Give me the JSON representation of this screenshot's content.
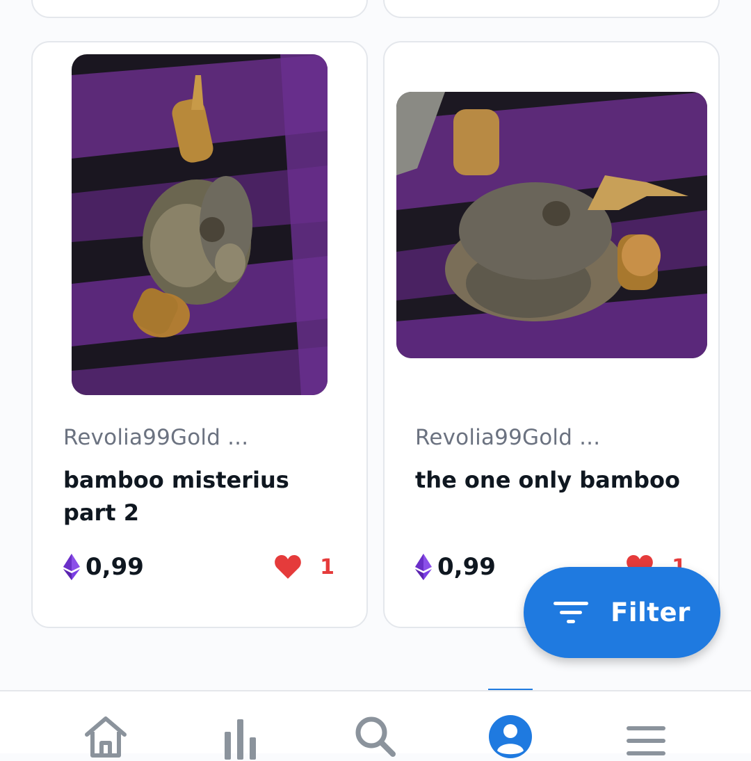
{
  "items": [
    {
      "owner": "Revolia99Gold ...",
      "title": "bamboo misterius part 2",
      "price": "0,99",
      "likes": "1",
      "currency_icon": "ethereum-icon",
      "like_icon": "heart-icon"
    },
    {
      "owner": "Revolia99Gold ...",
      "title": "the one only bamboo",
      "price": "0,99",
      "likes": "1",
      "currency_icon": "ethereum-icon",
      "like_icon": "heart-icon"
    }
  ],
  "filter_button": {
    "label": "Filter",
    "icon": "filter-icon"
  },
  "bottom_nav": {
    "items": [
      "home-icon",
      "stats-icon",
      "search-icon",
      "profile-icon",
      "menu-icon"
    ],
    "active": "profile-icon"
  },
  "colors": {
    "accent": "#1f7ae0",
    "like": "#e53b3b",
    "ethereum": "#7b3fe4",
    "muted_text": "#6b7280",
    "nav_icon": "#8b939c"
  }
}
